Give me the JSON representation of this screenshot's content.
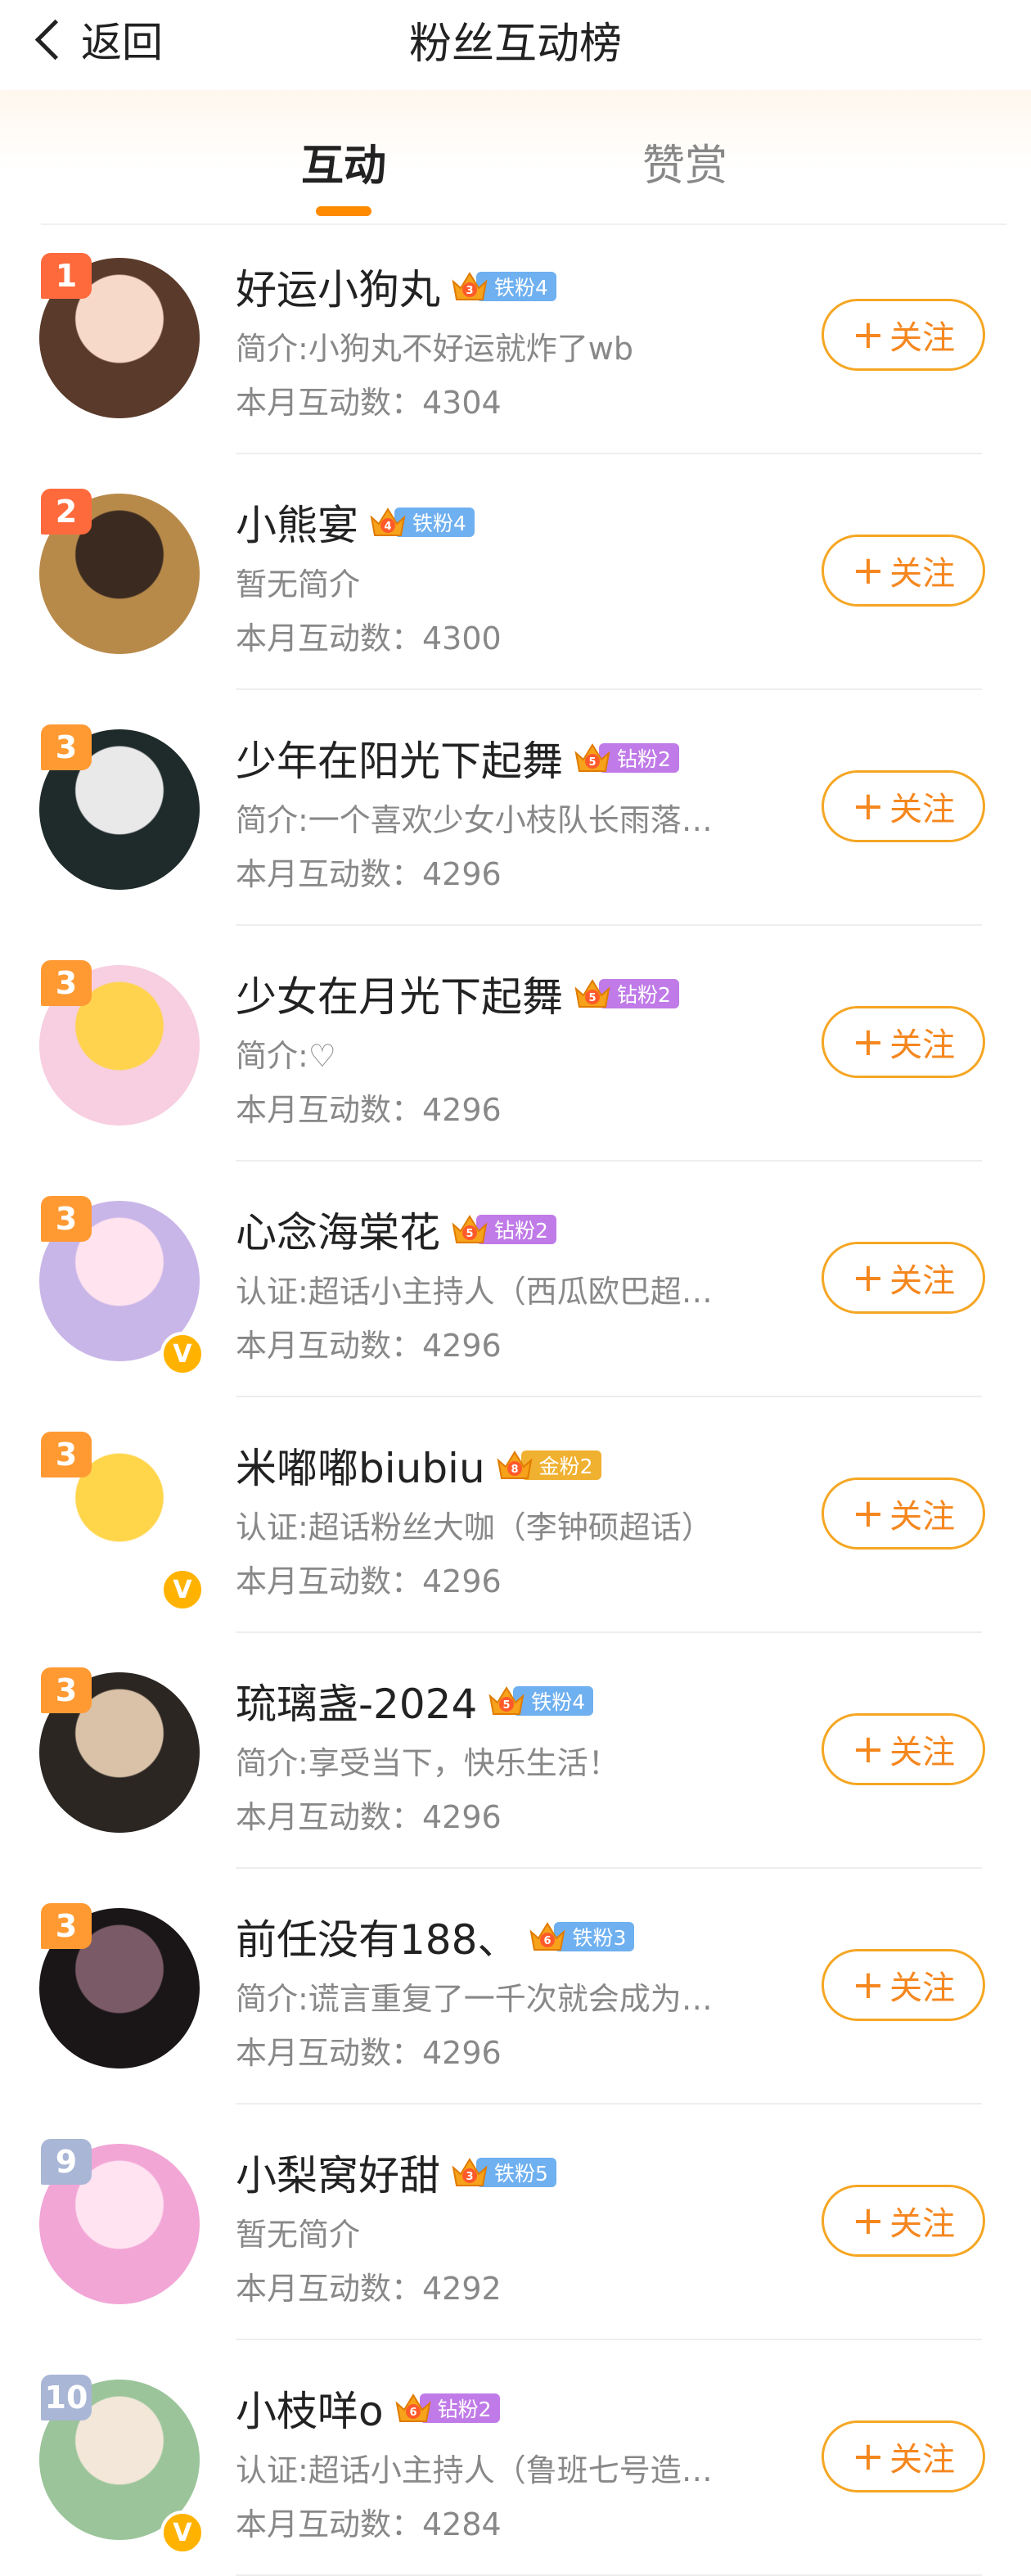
{
  "header": {
    "back_label": "返回",
    "title": "粉丝互动榜"
  },
  "tabs": [
    {
      "label": "互动",
      "active": true
    },
    {
      "label": "赞赏",
      "active": false
    }
  ],
  "follow_label": "关注",
  "follow_plus": "+",
  "colors": {
    "accent": "#ff8a00",
    "follow": "#f5871f",
    "rank_top": "#ff6a3d",
    "rank_normal": "#ff9a33",
    "rank_low": "#a9b6d6",
    "iron": "#6fb0f0",
    "diamond": "#c07be8",
    "gold": "#f0b030"
  },
  "users": [
    {
      "rank": "1",
      "name": "好运小狗丸",
      "level": "3",
      "badge": "铁粉4",
      "badge_type": "iron",
      "desc": "简介:小狗丸不好运就炸了wb",
      "count": "本月互动数：4304",
      "verified": false,
      "avatar": [
        "#5a3a2a",
        "#f7d9c9"
      ]
    },
    {
      "rank": "2",
      "name": "小熊宴",
      "level": "4",
      "badge": "铁粉4",
      "badge_type": "iron",
      "desc": "暂无简介",
      "count": "本月互动数：4300",
      "verified": false,
      "avatar": [
        "#b88a4a",
        "#3a2a20"
      ]
    },
    {
      "rank": "3",
      "name": "少年在阳光下起舞",
      "level": "5",
      "badge": "钻粉2",
      "badge_type": "diamond",
      "desc": "简介:一个喜欢少女小枝队长雨落…",
      "count": "本月互动数：4296",
      "verified": false,
      "avatar": [
        "#1f2b2a",
        "#e9e9e9"
      ]
    },
    {
      "rank": "3",
      "name": "少女在月光下起舞",
      "level": "5",
      "badge": "钻粉2",
      "badge_type": "diamond",
      "desc": "简介:♡",
      "count": "本月互动数：4296",
      "verified": false,
      "avatar": [
        "#f7cfe0",
        "#ffd34d"
      ]
    },
    {
      "rank": "3",
      "name": "心念海棠花",
      "level": "5",
      "badge": "钻粉2",
      "badge_type": "diamond",
      "desc": "认证:超话小主持人（西瓜欧巴超…",
      "count": "本月互动数：4296",
      "verified": true,
      "avatar": [
        "#c9b6e8",
        "#ffe3ef"
      ]
    },
    {
      "rank": "3",
      "name": "米嘟嘟biubiu",
      "level": "8",
      "badge": "金粉2",
      "badge_type": "gold",
      "desc": "认证:超话粉丝大咖（李钟硕超话）",
      "count": "本月互动数：4296",
      "verified": true,
      "avatar": [
        "#ffffff",
        "#ffd54a"
      ]
    },
    {
      "rank": "3",
      "name": "琉璃盏-2024",
      "level": "5",
      "badge": "铁粉4",
      "badge_type": "iron",
      "desc": "简介:享受当下，快乐生活！",
      "count": "本月互动数：4296",
      "verified": false,
      "avatar": [
        "#2b2622",
        "#d9c2a8"
      ]
    },
    {
      "rank": "3",
      "name": "前任没有188、",
      "level": "6",
      "badge": "铁粉3",
      "badge_type": "iron",
      "desc": "简介:谎言重复了一千次就会成为…",
      "count": "本月互动数：4296",
      "verified": false,
      "avatar": [
        "#1a1618",
        "#7a5a66"
      ]
    },
    {
      "rank": "9",
      "name": "小梨窝好甜",
      "level": "3",
      "badge": "铁粉5",
      "badge_type": "iron",
      "desc": "暂无简介",
      "count": "本月互动数：4292",
      "verified": false,
      "avatar": [
        "#f2a6d6",
        "#ffe3f1"
      ]
    },
    {
      "rank": "10",
      "name": "小枝咩o",
      "level": "6",
      "badge": "钻粉2",
      "badge_type": "diamond",
      "desc": "认证:超话小主持人（鲁班七号造…",
      "count": "本月互动数：4284",
      "verified": true,
      "avatar": [
        "#9bc49a",
        "#f3e7d9"
      ]
    }
  ]
}
